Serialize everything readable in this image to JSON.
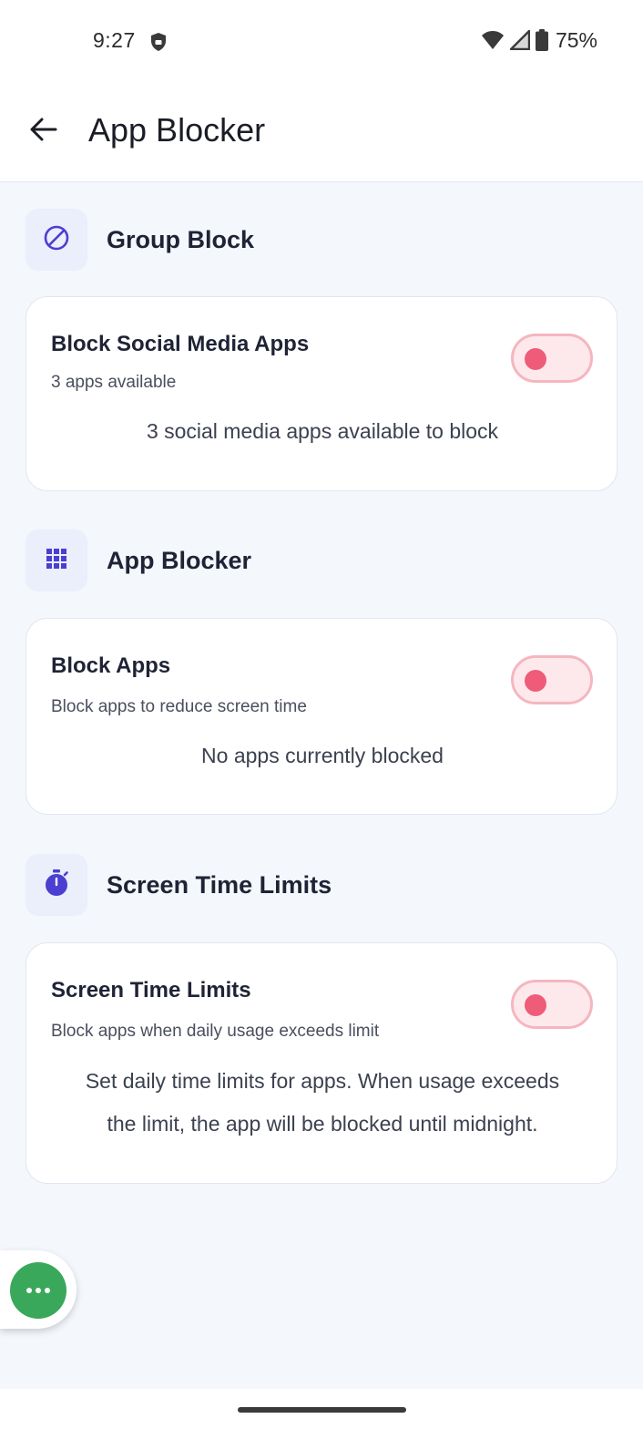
{
  "status_bar": {
    "time": "9:27",
    "battery_percent": "75%"
  },
  "app_bar": {
    "title": "App Blocker"
  },
  "sections": [
    {
      "icon": "block-icon",
      "title": "Group Block",
      "card": {
        "title": "Block Social Media Apps",
        "subtitle": "3 apps available",
        "description": "3 social media apps available to block",
        "toggle_on": false
      }
    },
    {
      "icon": "grid-icon",
      "title": "App Blocker",
      "card": {
        "title": "Block Apps",
        "subtitle": "Block apps to reduce screen time",
        "description": "No apps currently blocked",
        "toggle_on": false
      }
    },
    {
      "icon": "stopwatch-icon",
      "title": "Screen Time Limits",
      "card": {
        "title": "Screen Time Limits",
        "subtitle": "Block apps when daily usage exceeds limit",
        "description_lines": [
          "Set daily time limits for apps. When usage exceeds",
          "the limit, the app will be blocked until midnight."
        ],
        "toggle_on": false
      }
    }
  ],
  "colors": {
    "accent": "#4a3fd1",
    "toggle_off_track": "#fde9ec",
    "toggle_off_knob": "#ef5c78",
    "fab": "#3aa85a",
    "background": "#f4f7fc"
  },
  "fab": {
    "icon": "more-horizontal-icon"
  }
}
